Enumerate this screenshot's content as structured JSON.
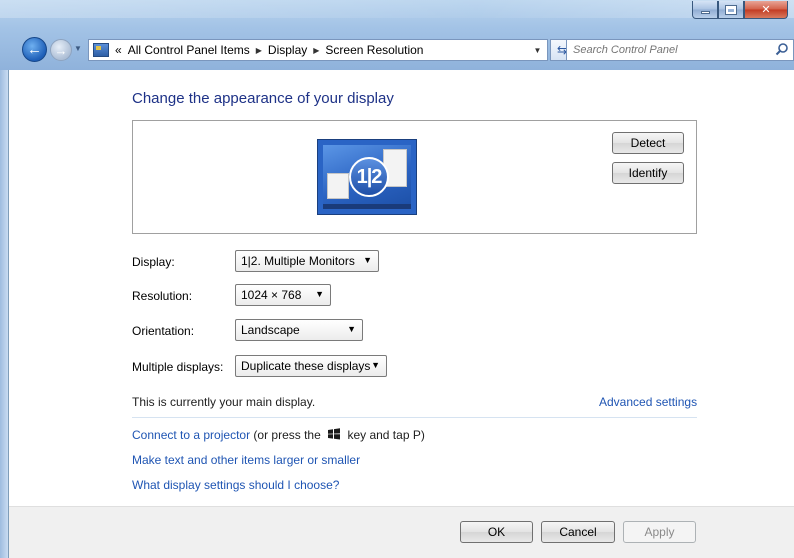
{
  "window": {
    "accent": "#1e3287",
    "link_color": "#1f55b3"
  },
  "nav": {
    "breadcrumbs": [
      "All Control Panel Items",
      "Display",
      "Screen Resolution"
    ],
    "overflow": "«",
    "search_placeholder": "Search Control Panel"
  },
  "page": {
    "heading": "Change the appearance of your display",
    "detect_label": "Detect",
    "identify_label": "Identify",
    "monitor_badge": "1|2"
  },
  "settings": {
    "display_label": "Display:",
    "display_value": "1|2. Multiple Monitors",
    "resolution_label": "Resolution:",
    "resolution_value": "1024 × 768",
    "orientation_label": "Orientation:",
    "orientation_value": "Landscape",
    "multiple_label": "Multiple displays:",
    "multiple_value": "Duplicate these displays"
  },
  "info": {
    "main_display": "This is currently your main display.",
    "advanced": "Advanced settings",
    "projector_link": "Connect to a projector",
    "projector_hint_pre": " (or press the ",
    "projector_hint_post": " key and tap P)",
    "text_size_link": "Make text and other items larger or smaller",
    "help_link": "What display settings should I choose?"
  },
  "footer": {
    "ok": "OK",
    "cancel": "Cancel",
    "apply": "Apply"
  }
}
